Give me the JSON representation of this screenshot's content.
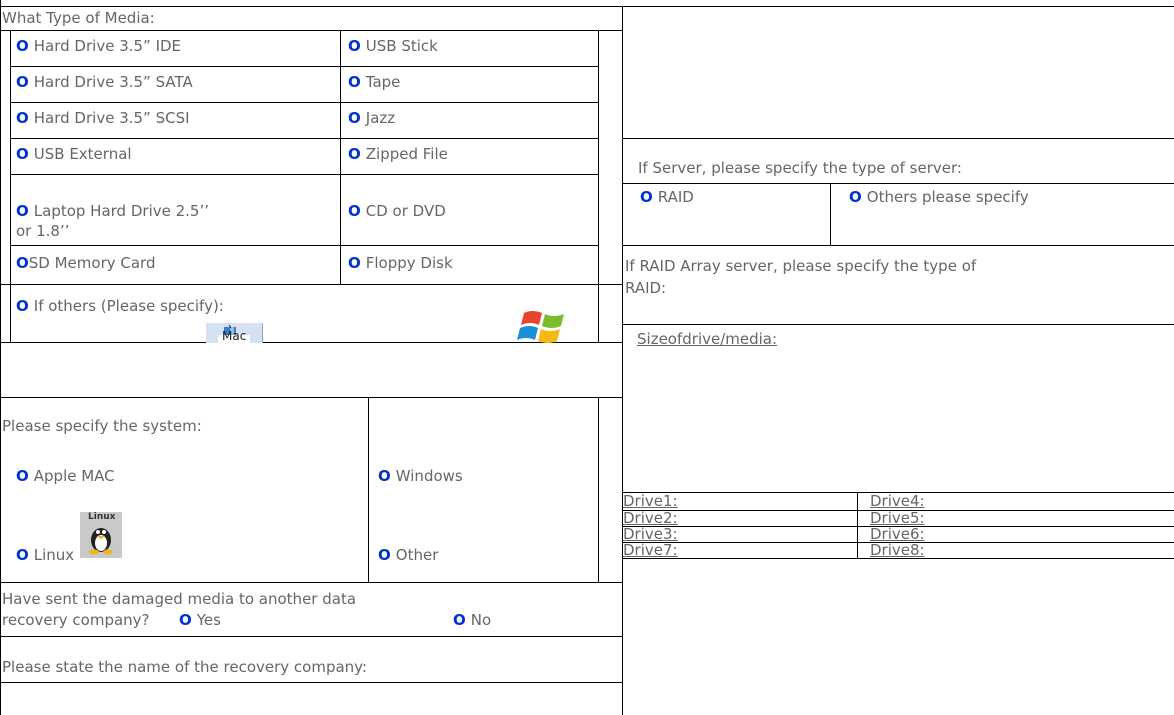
{
  "colors": {
    "radio_glyph": "#0033cc",
    "text": "#666666",
    "border": "#000000"
  },
  "radio_glyph": "O",
  "media": {
    "heading": "What Type of Media:",
    "options_left": [
      "Hard Drive 3.5” IDE",
      "Hard Drive 3.5” SATA",
      "Hard Drive 3.5” SCSI",
      "USB External",
      "Laptop Hard Drive 2.5’’",
      "SD Memory Card"
    ],
    "laptop_line2": "or 1.8’’",
    "options_right": [
      "USB Stick",
      "Tape",
      "Jazz",
      "Zipped File",
      "CD or DVD",
      "Floppy Disk"
    ],
    "others": "If others (Please specify):",
    "mac_logo_label": "Mac"
  },
  "system": {
    "heading": "Please specify the system:",
    "apple": "Apple MAC",
    "windows": "Windows",
    "linux": "Linux",
    "linux_logo_label": "Linux",
    "other": "Other"
  },
  "recovery": {
    "question_line1": "Have sent the damaged media to another data",
    "question_line2": "recovery company?",
    "yes": "Yes",
    "no": "No",
    "company_prompt": "Please state the name of the recovery company:"
  },
  "server": {
    "prompt": "If Server, please specify the type of server:",
    "raid": "RAID",
    "others": "Others please specify"
  },
  "raid_array": {
    "prompt_line1": "If RAID Array server, please specify the type of",
    "prompt_line2": "RAID:"
  },
  "size": {
    "label": "Sizeofdrive/media:",
    "drives_left": [
      "Drive1:",
      "Drive2:",
      "Drive3:",
      "Drive7:"
    ],
    "drives_right": [
      "Drive4:",
      "Drive5:",
      "Drive6:",
      "Drive8:"
    ]
  }
}
